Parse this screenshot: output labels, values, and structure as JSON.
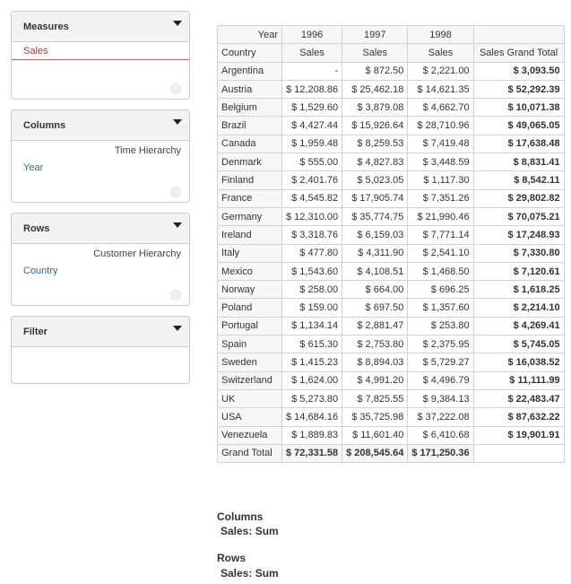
{
  "panels": {
    "measures": {
      "title": "Measures",
      "item": "Sales"
    },
    "columns": {
      "title": "Columns",
      "hierarchy": "Time Hierarchy",
      "level": "Year"
    },
    "rows": {
      "title": "Rows",
      "hierarchy": "Customer Hierarchy",
      "level": "Country"
    },
    "filter": {
      "title": "Filter"
    }
  },
  "table": {
    "corner_col_label": "Year",
    "corner_row_label": "Country",
    "years": [
      "1996",
      "1997",
      "1998"
    ],
    "measure_label": "Sales",
    "grand_total_col_label": "Sales Grand Total",
    "rows": [
      {
        "country": "Argentina",
        "v": [
          "-",
          "$ 872.50",
          "$ 2,221.00"
        ],
        "total": "$ 3,093.50"
      },
      {
        "country": "Austria",
        "v": [
          "$ 12,208.86",
          "$ 25,462.18",
          "$ 14,621.35"
        ],
        "total": "$ 52,292.39"
      },
      {
        "country": "Belgium",
        "v": [
          "$ 1,529.60",
          "$ 3,879.08",
          "$ 4,662.70"
        ],
        "total": "$ 10,071.38"
      },
      {
        "country": "Brazil",
        "v": [
          "$ 4,427.44",
          "$ 15,926.64",
          "$ 28,710.96"
        ],
        "total": "$ 49,065.05"
      },
      {
        "country": "Canada",
        "v": [
          "$ 1,959.48",
          "$ 8,259.53",
          "$ 7,419.48"
        ],
        "total": "$ 17,638.48"
      },
      {
        "country": "Denmark",
        "v": [
          "$ 555.00",
          "$ 4,827.83",
          "$ 3,448.59"
        ],
        "total": "$ 8,831.41"
      },
      {
        "country": "Finland",
        "v": [
          "$ 2,401.76",
          "$ 5,023.05",
          "$ 1,117.30"
        ],
        "total": "$ 8,542.11"
      },
      {
        "country": "France",
        "v": [
          "$ 4,545.82",
          "$ 17,905.74",
          "$ 7,351.26"
        ],
        "total": "$ 29,802.82"
      },
      {
        "country": "Germany",
        "v": [
          "$ 12,310.00",
          "$ 35,774.75",
          "$ 21,990.46"
        ],
        "total": "$ 70,075.21"
      },
      {
        "country": "Ireland",
        "v": [
          "$ 3,318.76",
          "$ 6,159.03",
          "$ 7,771.14"
        ],
        "total": "$ 17,248.93"
      },
      {
        "country": "Italy",
        "v": [
          "$ 477.80",
          "$ 4,311.90",
          "$ 2,541.10"
        ],
        "total": "$ 7,330.80"
      },
      {
        "country": "Mexico",
        "v": [
          "$ 1,543.60",
          "$ 4,108.51",
          "$ 1,468.50"
        ],
        "total": "$ 7,120.61"
      },
      {
        "country": "Norway",
        "v": [
          "$ 258.00",
          "$ 664.00",
          "$ 696.25"
        ],
        "total": "$ 1,618.25"
      },
      {
        "country": "Poland",
        "v": [
          "$ 159.00",
          "$ 697.50",
          "$ 1,357.60"
        ],
        "total": "$ 2,214.10"
      },
      {
        "country": "Portugal",
        "v": [
          "$ 1,134.14",
          "$ 2,881.47",
          "$ 253.80"
        ],
        "total": "$ 4,269.41"
      },
      {
        "country": "Spain",
        "v": [
          "$ 615.30",
          "$ 2,753.80",
          "$ 2,375.95"
        ],
        "total": "$ 5,745.05"
      },
      {
        "country": "Sweden",
        "v": [
          "$ 1,415.23",
          "$ 8,894.03",
          "$ 5,729.27"
        ],
        "total": "$ 16,038.52"
      },
      {
        "country": "Switzerland",
        "v": [
          "$ 1,624.00",
          "$ 4,991.20",
          "$ 4,496.79"
        ],
        "total": "$ 11,111.99"
      },
      {
        "country": "UK",
        "v": [
          "$ 5,273.80",
          "$ 7,825.55",
          "$ 9,384.13"
        ],
        "total": "$ 22,483.47"
      },
      {
        "country": "USA",
        "v": [
          "$ 14,684.16",
          "$ 35,725.98",
          "$ 37,222.08"
        ],
        "total": "$ 87,632.22"
      },
      {
        "country": "Venezuela",
        "v": [
          "$ 1,889.83",
          "$ 11,601.40",
          "$ 6,410.68"
        ],
        "total": "$ 19,901.91"
      }
    ],
    "grand_total": {
      "label": "Grand Total",
      "v": [
        "$ 72,331.58",
        "$ 208,545.64",
        "$ 171,250.36"
      ]
    }
  },
  "summary": {
    "columns_title": "Columns",
    "columns_item": "Sales: Sum",
    "rows_title": "Rows",
    "rows_item": "Sales: Sum"
  }
}
